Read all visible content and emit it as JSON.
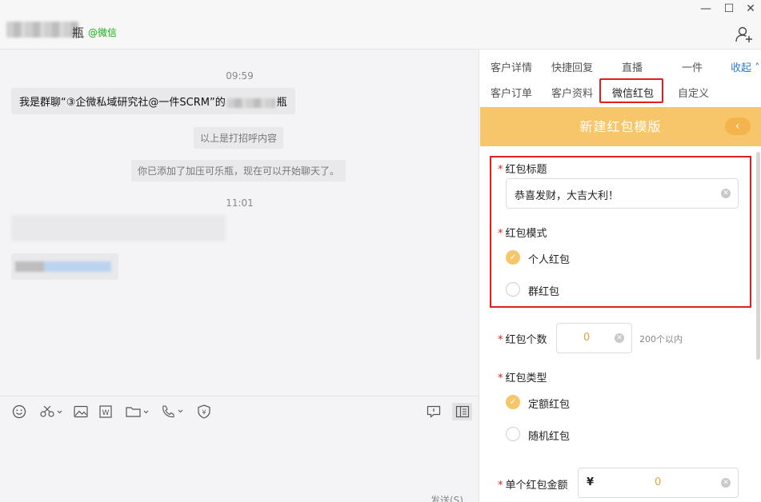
{
  "header": {
    "name_tail": "瓶",
    "wechat_tag": "@微信",
    "minimize_label": "—",
    "maximize_label": "☐",
    "close_label": "✕"
  },
  "chat": {
    "messages": [
      {
        "kind": "time",
        "text": "09:59"
      },
      {
        "kind": "bubble",
        "text_before": "我是群聊“③企微私域研究社@一件SCRM”的",
        "text_after": "瓶"
      },
      {
        "kind": "system",
        "text": "以上是打招呼内容"
      },
      {
        "kind": "system",
        "text": "你已添加了加压可乐瓶，现在可以开始聊天了。"
      },
      {
        "kind": "time",
        "text": "11:01"
      }
    ]
  },
  "input": {
    "send_label": "发送(S)"
  },
  "tabs": {
    "row1": [
      "客户详情",
      "快捷回复",
      "直播",
      "一件"
    ],
    "row2": [
      "客户订单",
      "客户资料",
      "微信红包",
      "自定义"
    ],
    "collapse_label": "收起",
    "active": "微信红包"
  },
  "banner": {
    "title": "新建红包模版",
    "back_label": "‹"
  },
  "form": {
    "title_label": "红包标题",
    "title_value": "恭喜发财，大吉大利！",
    "mode_label": "红包模式",
    "mode_options": [
      "个人红包",
      "群红包"
    ],
    "mode_selected": 0,
    "count_label": "红包个数",
    "count_value": "0",
    "count_hint": "200个以内",
    "type_label": "红包类型",
    "type_options": [
      "定额红包",
      "随机红包"
    ],
    "type_selected": 0,
    "amount_label": "单个红包金额",
    "currency": "¥",
    "amount_value": "0",
    "required_mark": "*"
  },
  "colors": {
    "accent": "#f8c66a",
    "highlight_border": "#e02020",
    "wechat_green": "#1aad19",
    "link_blue": "#2f7bd8"
  }
}
